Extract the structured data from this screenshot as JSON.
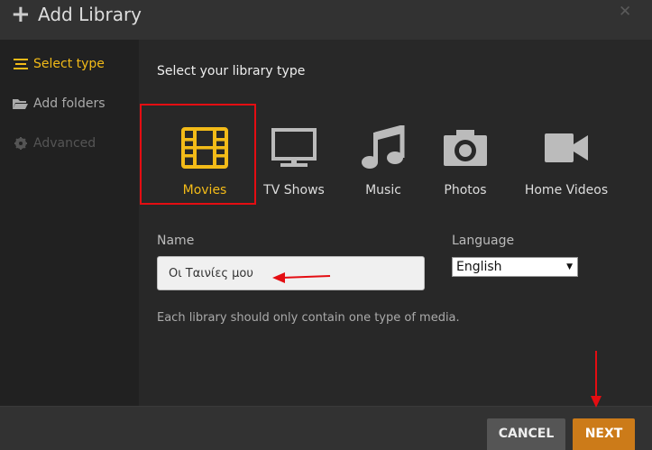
{
  "header": {
    "title": "Add Library",
    "close_glyph": "✕"
  },
  "sidebar": {
    "items": [
      {
        "label": "Select type",
        "icon": "list-icon",
        "state": "active"
      },
      {
        "label": "Add folders",
        "icon": "folder-icon",
        "state": "normal"
      },
      {
        "label": "Advanced",
        "icon": "gear-icon",
        "state": "disabled"
      }
    ]
  },
  "main": {
    "section_title": "Select your library type",
    "types": [
      {
        "label": "Movies",
        "icon": "film-icon",
        "selected": true
      },
      {
        "label": "TV Shows",
        "icon": "tv-icon",
        "selected": false
      },
      {
        "label": "Music",
        "icon": "music-note-icon",
        "selected": false
      },
      {
        "label": "Photos",
        "icon": "camera-icon",
        "selected": false
      },
      {
        "label": "Home Videos",
        "icon": "video-camera-icon",
        "selected": false
      }
    ],
    "name_label": "Name",
    "name_value": "Οι Ταινίες μου",
    "language_label": "Language",
    "language_value": "English",
    "help_text": "Each library should only contain one type of media."
  },
  "footer": {
    "cancel_label": "CANCEL",
    "next_label": "NEXT"
  },
  "colors": {
    "accent": "#f3bb18",
    "next_button": "#cc7b19",
    "annotation_red": "#e40d12"
  }
}
